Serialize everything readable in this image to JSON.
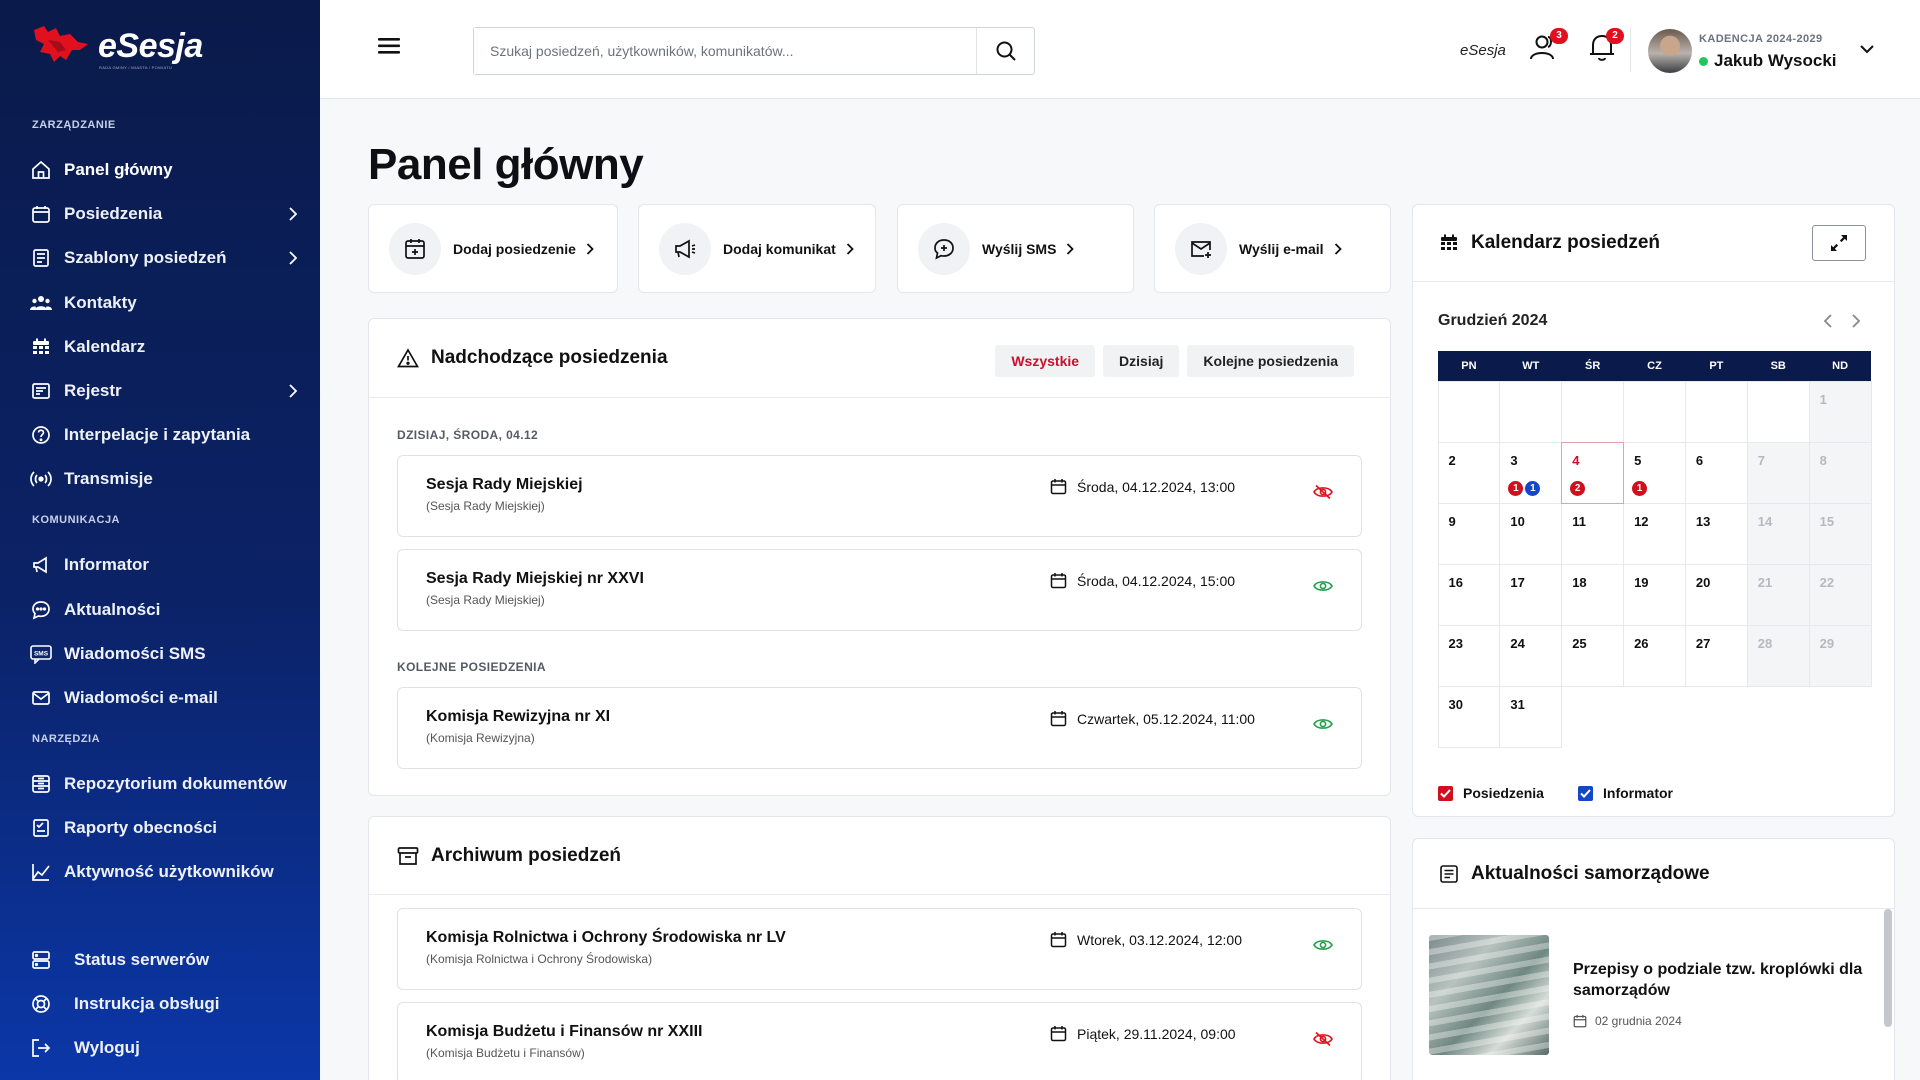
{
  "sidebar": {
    "logo_text": "eSesja",
    "logo_sub": "RADA GMINY / MIASTA / POWIATU",
    "sections": {
      "management": "ZARZĄDZANIE",
      "communication": "KOMUNIKACJA",
      "tools": "NARZĘDZIA"
    },
    "items": [
      {
        "label": "Panel główny",
        "icon": "home-icon"
      },
      {
        "label": "Posiedzenia",
        "icon": "calendar-icon"
      },
      {
        "label": "Szablony posiedzeń",
        "icon": "document-icon"
      },
      {
        "label": "Kontakty",
        "icon": "people-icon"
      },
      {
        "label": "Kalendarz",
        "icon": "calendar-grid-icon"
      },
      {
        "label": "Rejestr",
        "icon": "register-icon"
      },
      {
        "label": "Interpelacje i zapytania",
        "icon": "question-icon"
      },
      {
        "label": "Transmisje",
        "icon": "broadcast-icon"
      },
      {
        "label": "Informator",
        "icon": "megaphone-icon"
      },
      {
        "label": "Aktualności",
        "icon": "chat-icon"
      },
      {
        "label": "Wiadomości SMS",
        "icon": "sms-icon"
      },
      {
        "label": "Wiadomości e-mail",
        "icon": "mail-icon"
      },
      {
        "label": "Repozytorium dokumentów",
        "icon": "repository-icon"
      },
      {
        "label": "Raporty obecności",
        "icon": "attendance-icon"
      },
      {
        "label": "Aktywność użytkowników",
        "icon": "chart-line-icon"
      }
    ],
    "bottom": [
      {
        "label": "Status serwerów",
        "icon": "server-icon"
      },
      {
        "label": "Instrukcja obsługi",
        "icon": "lifebuoy-icon"
      },
      {
        "label": "Wyloguj",
        "icon": "logout-icon"
      }
    ]
  },
  "topbar": {
    "search_placeholder": "Szukaj posiedzeń, użytkowników, komunikatów...",
    "brand": "eSesja",
    "users_badge": "3",
    "notifications_badge": "2",
    "term": "KADENCJA 2024-2029",
    "user_name": "Jakub Wysocki"
  },
  "page": {
    "title": "Panel główny"
  },
  "quick_actions": [
    {
      "label": "Dodaj posiedzenie",
      "icon": "calendar-add-icon"
    },
    {
      "label": "Dodaj komunikat",
      "icon": "megaphone-icon"
    },
    {
      "label": "Wyślij SMS",
      "icon": "sms-bubble-icon"
    },
    {
      "label": "Wyślij e-mail",
      "icon": "mail-add-icon"
    }
  ],
  "upcoming": {
    "title": "Nadchodzące posiedzenia",
    "filters": [
      "Wszystkie",
      "Dzisiaj",
      "Kolejne posiedzenia"
    ],
    "today_label": "DZISIAJ, ŚRODA, 04.12",
    "next_label": "KOLEJNE POSIEDZENIA",
    "today": [
      {
        "title": "Sesja Rady Miejskiej",
        "sub": "(Sesja Rady Miejskiej)",
        "date": "Środa, 04.12.2024, 13:00",
        "visible": false
      },
      {
        "title": "Sesja Rady Miejskiej nr XXVI",
        "sub": "(Sesja Rady Miejskiej)",
        "date": "Środa, 04.12.2024, 15:00",
        "visible": true
      }
    ],
    "next": [
      {
        "title": "Komisja Rewizyjna nr XI",
        "sub": "(Komisja Rewizyjna)",
        "date": "Czwartek, 05.12.2024, 11:00",
        "visible": true
      }
    ]
  },
  "archive": {
    "title": "Archiwum posiedzeń",
    "items": [
      {
        "title": "Komisja Rolnictwa i Ochrony Środowiska nr LV",
        "sub": "(Komisja Rolnictwa i Ochrony Środowiska)",
        "date": "Wtorek, 03.12.2024, 12:00",
        "visible": true
      },
      {
        "title": "Komisja Budżetu i Finansów nr XXIII",
        "sub": "(Komisja Budżetu i Finansów)",
        "date": "Piątek, 29.11.2024, 09:00",
        "visible": false
      }
    ]
  },
  "calendar": {
    "title": "Kalendarz posiedzeń",
    "month": "Grudzień 2024",
    "weekdays": [
      "PN",
      "WT",
      "ŚR",
      "CZ",
      "PT",
      "SB",
      "ND"
    ],
    "leading_empty": 6,
    "days_in_month": 31,
    "today": 4,
    "events": {
      "3": [
        {
          "c": "r",
          "n": "1"
        },
        {
          "c": "b",
          "n": "1"
        }
      ],
      "4": [
        {
          "c": "r",
          "n": "2"
        }
      ],
      "5": [
        {
          "c": "r",
          "n": "1"
        }
      ]
    },
    "legend": [
      {
        "label": "Posiedzenia",
        "color": "#d0101e"
      },
      {
        "label": "Informator",
        "color": "#1447c8"
      }
    ]
  },
  "news": {
    "title": "Aktualności samorządowe",
    "item_title": "Przepisy o podziale tzw. kroplówki dla samorządów",
    "item_date": "02 grudnia 2024"
  }
}
